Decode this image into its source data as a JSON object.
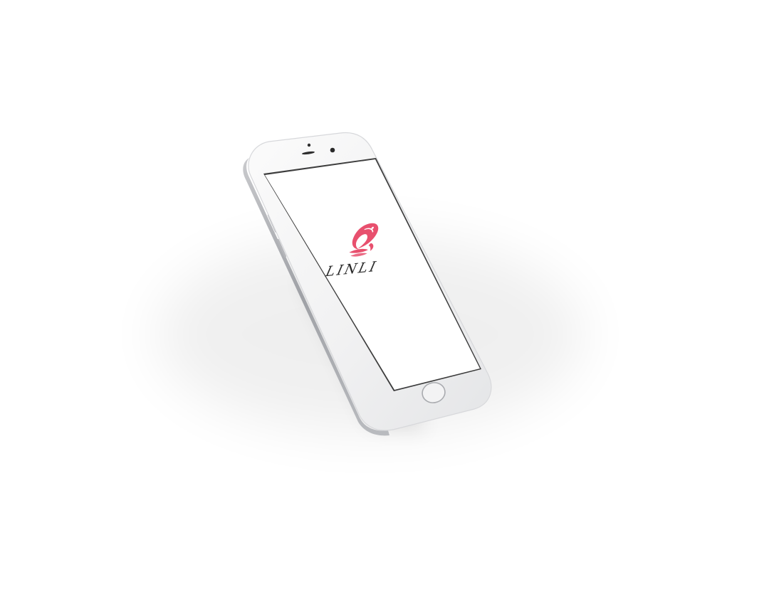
{
  "app": {
    "brand_name": "LINLI",
    "logo": {
      "icon": "koi-fish-icon",
      "color": "#e8506e"
    }
  },
  "device": {
    "model": "smartphone",
    "body_color": "#f4f4f5",
    "frame_color": "#cfd0d3",
    "screen_color": "#ffffff"
  },
  "colors": {
    "text": "#2a2a2a",
    "background": "#ffffff"
  }
}
